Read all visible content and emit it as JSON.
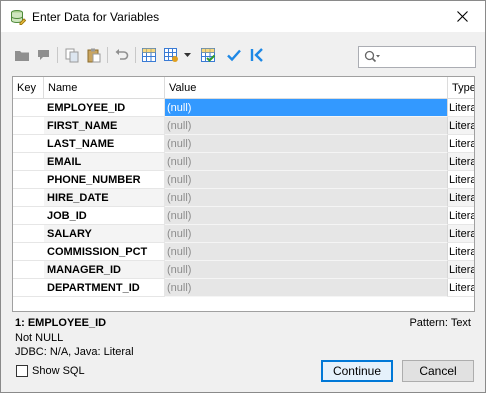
{
  "window": {
    "title": "Enter Data for Variables"
  },
  "toolbar": {
    "buttons": [
      {
        "icon": "folder-icon"
      },
      {
        "icon": "comment-icon"
      },
      {
        "icon": "copy-icon"
      },
      {
        "icon": "paste-icon"
      },
      {
        "icon": "undo-icon"
      },
      {
        "icon": "grid-icon"
      },
      {
        "icon": "grid-settings-icon"
      },
      {
        "icon": "dropdown-arrow-icon"
      },
      {
        "icon": "grid-check-icon"
      },
      {
        "icon": "checkmark-icon"
      },
      {
        "icon": "set-all-icon"
      }
    ],
    "search": {
      "placeholder": "",
      "value": ""
    }
  },
  "grid": {
    "columns": [
      "Key",
      "Name",
      "Value",
      "Type"
    ],
    "rows": [
      {
        "name": "EMPLOYEE_ID",
        "value": "(null)",
        "type": "Literal"
      },
      {
        "name": "FIRST_NAME",
        "value": "(null)",
        "type": "Literal"
      },
      {
        "name": "LAST_NAME",
        "value": "(null)",
        "type": "Literal"
      },
      {
        "name": "EMAIL",
        "value": "(null)",
        "type": "Literal"
      },
      {
        "name": "PHONE_NUMBER",
        "value": "(null)",
        "type": "Literal"
      },
      {
        "name": "HIRE_DATE",
        "value": "(null)",
        "type": "Literal"
      },
      {
        "name": "JOB_ID",
        "value": "(null)",
        "type": "Literal"
      },
      {
        "name": "SALARY",
        "value": "(null)",
        "type": "Literal"
      },
      {
        "name": "COMMISSION_PCT",
        "value": "(null)",
        "type": "Literal"
      },
      {
        "name": "MANAGER_ID",
        "value": "(null)",
        "type": "Literal"
      },
      {
        "name": "DEPARTMENT_ID",
        "value": "(null)",
        "type": "Literal"
      }
    ]
  },
  "info": {
    "selected": "1: EMPLOYEE_ID",
    "nullability": "Not NULL",
    "types": "JDBC: N/A, Java: Literal",
    "pattern": "Pattern: Text"
  },
  "footer": {
    "show_sql_label": "Show SQL",
    "show_sql_checked": false,
    "continue_label": "Continue",
    "cancel_label": "Cancel"
  },
  "colors": {
    "accent": "#0078d7",
    "selection": "#3399ff",
    "value_cell": "#e6e6e6"
  }
}
